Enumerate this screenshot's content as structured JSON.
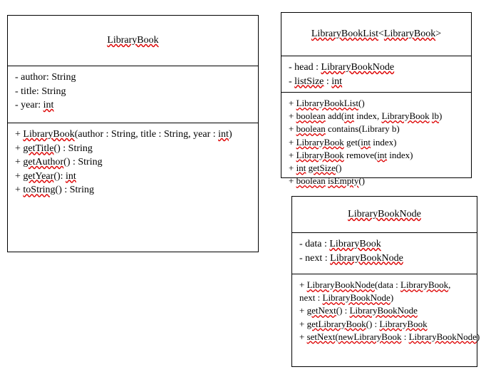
{
  "classes": {
    "libraryBook": {
      "title": {
        "label": "LibraryBook",
        "underline": true
      },
      "attrs": [
        {
          "segs": [
            {
              "t": "- author: String"
            }
          ]
        },
        {
          "segs": [
            {
              "t": "- title: String"
            }
          ]
        },
        {
          "segs": [
            {
              "t": "- year: "
            },
            {
              "t": "int",
              "u": true
            }
          ]
        }
      ],
      "ops": [
        {
          "segs": [
            {
              "t": "+ "
            },
            {
              "t": "LibraryBook",
              "u": true
            },
            {
              "t": "(author : String, title : String, year : "
            },
            {
              "t": "int",
              "u": true
            },
            {
              "t": ")"
            }
          ]
        },
        {
          "segs": [
            {
              "t": "+ "
            },
            {
              "t": "getTitle",
              "u": true
            },
            {
              "t": "() : String"
            }
          ]
        },
        {
          "segs": [
            {
              "t": "+ "
            },
            {
              "t": "getAuthor",
              "u": true
            },
            {
              "t": "() : String"
            }
          ]
        },
        {
          "segs": [
            {
              "t": "+ "
            },
            {
              "t": "getYear",
              "u": true
            },
            {
              "t": "(): "
            },
            {
              "t": "int",
              "u": true
            }
          ]
        },
        {
          "segs": [
            {
              "t": "+ "
            },
            {
              "t": "toString",
              "u": true
            },
            {
              "t": "() : String"
            }
          ]
        }
      ]
    },
    "libraryBookList": {
      "title": {
        "segs": [
          {
            "t": "LibraryBookList",
            "u": true
          },
          {
            "t": "<"
          },
          {
            "t": "LibraryBook",
            "u": true
          },
          {
            "t": ">"
          }
        ]
      },
      "attrs": [
        {
          "segs": [
            {
              "t": "- head : "
            },
            {
              "t": "LibraryBookNode",
              "u": true
            }
          ]
        },
        {
          "segs": [
            {
              "t": "- "
            },
            {
              "t": "listSize",
              "u": true
            },
            {
              "t": " : "
            },
            {
              "t": "int",
              "u": true
            }
          ]
        }
      ],
      "ops": [
        {
          "segs": [
            {
              "t": "+ "
            },
            {
              "t": "LibraryBookList",
              "u": true
            },
            {
              "t": "()"
            }
          ]
        },
        {
          "segs": [
            {
              "t": "+ "
            },
            {
              "t": "boolean",
              "u": true
            },
            {
              "t": " add("
            },
            {
              "t": "int",
              "u": true
            },
            {
              "t": " index, "
            },
            {
              "t": "LibraryBook",
              "u": true
            },
            {
              "t": " "
            },
            {
              "t": "lb",
              "u": true
            },
            {
              "t": ")"
            }
          ]
        },
        {
          "segs": [
            {
              "t": "+ "
            },
            {
              "t": "boolean",
              "u": true
            },
            {
              "t": " contains(Library b)"
            }
          ]
        },
        {
          "segs": [
            {
              "t": "+ "
            },
            {
              "t": "LibraryBook",
              "u": true
            },
            {
              "t": " get("
            },
            {
              "t": "int",
              "u": true
            },
            {
              "t": " index)"
            }
          ]
        },
        {
          "segs": [
            {
              "t": "+ "
            },
            {
              "t": "LibraryBook",
              "u": true
            },
            {
              "t": " remove("
            },
            {
              "t": "int",
              "u": true
            },
            {
              "t": " index)"
            }
          ]
        },
        {
          "segs": [
            {
              "t": "+ "
            },
            {
              "t": "int",
              "u": true
            },
            {
              "t": " "
            },
            {
              "t": "getSize",
              "u": true
            },
            {
              "t": "()"
            }
          ]
        },
        {
          "segs": [
            {
              "t": "+ "
            },
            {
              "t": "boolean",
              "u": true
            },
            {
              "t": " "
            },
            {
              "t": "isEmpty",
              "u": true
            },
            {
              "t": "()"
            }
          ]
        }
      ]
    },
    "libraryBookNode": {
      "title": {
        "label": "LibraryBookNode",
        "underline": true
      },
      "attrs": [
        {
          "segs": [
            {
              "t": "- data : "
            },
            {
              "t": "LibraryBook",
              "u": true
            }
          ]
        },
        {
          "segs": [
            {
              "t": "- next : "
            },
            {
              "t": "LibraryBookNode",
              "u": true
            }
          ]
        }
      ],
      "ops": [
        {
          "segs": [
            {
              "t": "+ "
            },
            {
              "t": "LibraryBookNode",
              "u": true
            },
            {
              "t": "(data : "
            },
            {
              "t": "LibraryBook",
              "u": true
            },
            {
              "t": ","
            }
          ]
        },
        {
          "segs": [
            {
              "t": "next : "
            },
            {
              "t": "LibraryBookNode",
              "u": true
            },
            {
              "t": ")"
            }
          ]
        },
        {
          "segs": [
            {
              "t": "+ "
            },
            {
              "t": "getNext",
              "u": true
            },
            {
              "t": "() : "
            },
            {
              "t": "LibraryBookNode",
              "u": true
            }
          ]
        },
        {
          "segs": [
            {
              "t": "+ "
            },
            {
              "t": "getLibraryBook",
              "u": true
            },
            {
              "t": "() : "
            },
            {
              "t": "LibraryBook",
              "u": true
            }
          ]
        },
        {
          "segs": [
            {
              "t": "+ "
            },
            {
              "t": "setNext",
              "u": true
            },
            {
              "t": "("
            },
            {
              "t": "newLibraryBook",
              "u": true
            },
            {
              "t": " : "
            },
            {
              "t": "LibraryBookNode",
              "u": true
            },
            {
              "t": ")"
            }
          ]
        }
      ]
    }
  }
}
